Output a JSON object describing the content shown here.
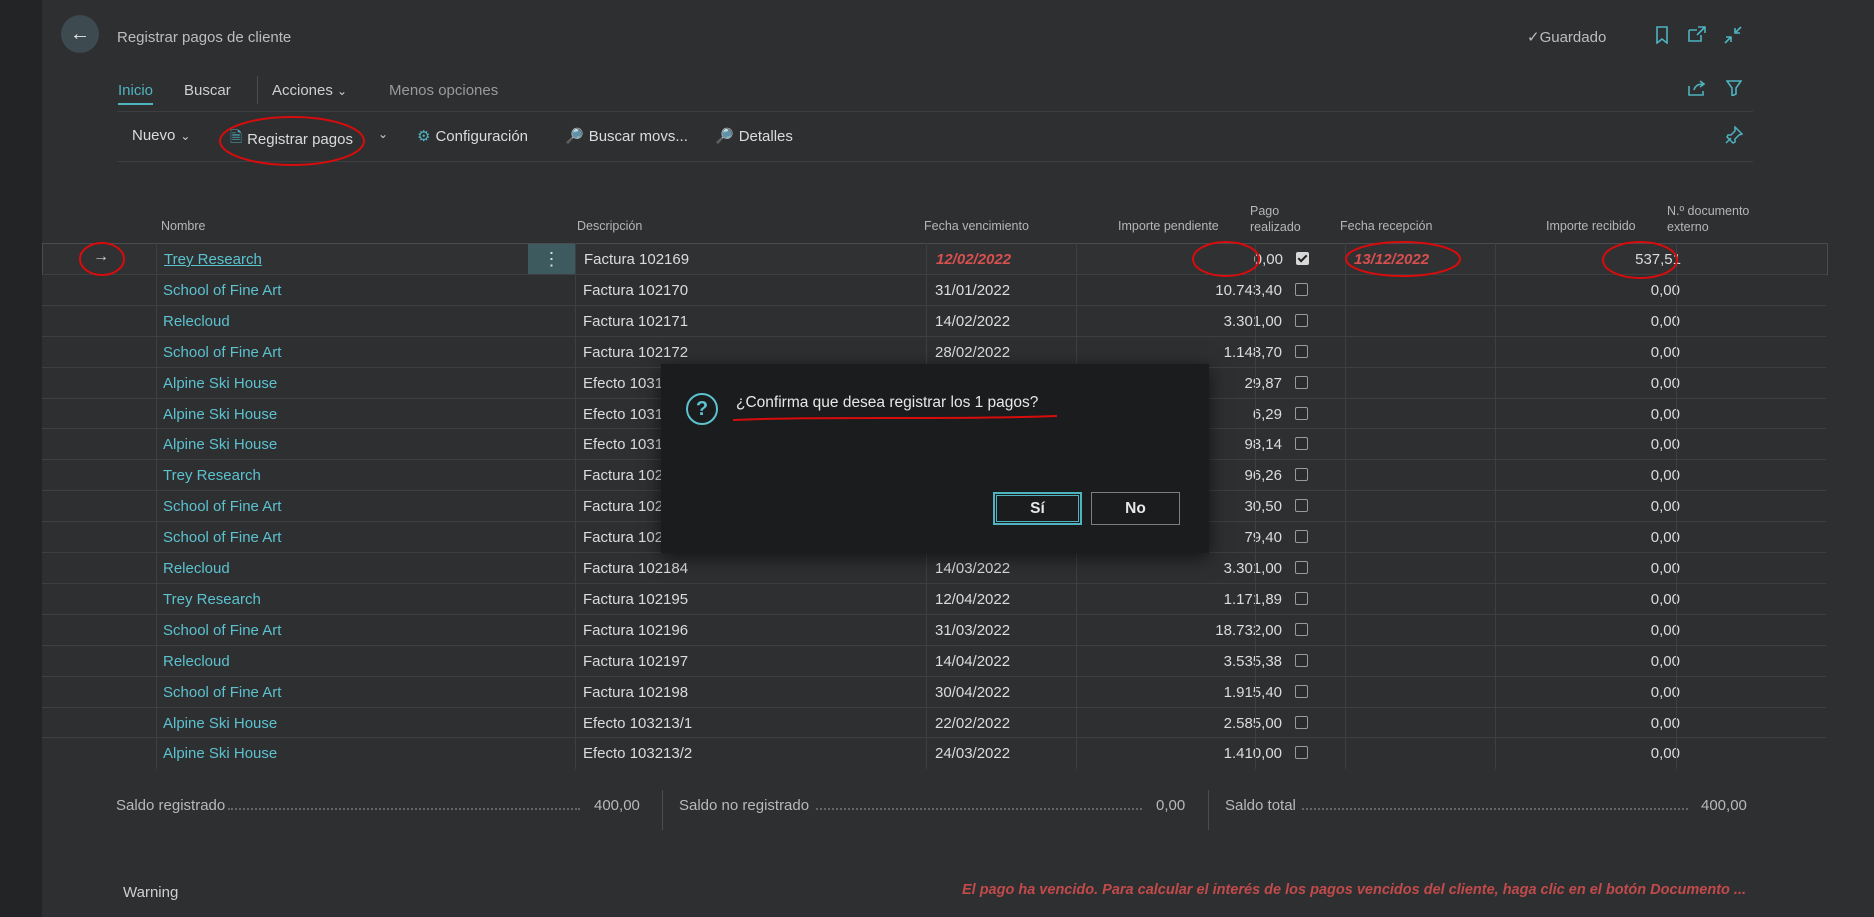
{
  "header": {
    "title": "Registrar pagos de cliente",
    "saved_label": "Guardado"
  },
  "tabs": [
    {
      "label": "Inicio",
      "active": true
    },
    {
      "label": "Buscar"
    },
    {
      "label": "Acciones"
    },
    {
      "label": "Menos opciones"
    }
  ],
  "actions": {
    "nuevo": "Nuevo",
    "registrar_pagos": "Registrar pagos",
    "configuracion": "Configuración",
    "buscar_movs": "Buscar movs...",
    "detalles": "Detalles"
  },
  "columns": {
    "nombre": "Nombre",
    "descripcion": "Descripción",
    "fecha_vencimiento": "Fecha vencimiento",
    "importe_pendiente": "Importe pendiente",
    "pago_realizado_1": "Pago",
    "pago_realizado_2": "realizado",
    "fecha_recepcion": "Fecha recepción",
    "importe_recibido": "Importe recibido",
    "doc_externo_1": "N.º documento",
    "doc_externo_2": "externo"
  },
  "rows": [
    {
      "name": "Trey Research",
      "desc": "Factura 102169",
      "due": "12/02/2022",
      "pending": "0,00",
      "paid": true,
      "received_date": "13/12/2022",
      "received": "537,51"
    },
    {
      "name": "School of Fine Art",
      "desc": "Factura 102170",
      "due": "31/01/2022",
      "pending": "10.743,40",
      "paid": false,
      "received_date": "",
      "received": "0,00"
    },
    {
      "name": "Relecloud",
      "desc": "Factura 102171",
      "due": "14/02/2022",
      "pending": "3.301,00",
      "paid": false,
      "received_date": "",
      "received": "0,00"
    },
    {
      "name": "School of Fine Art",
      "desc": "Factura 102172",
      "due": "28/02/2022",
      "pending": "1.148,70",
      "paid": false,
      "received_date": "",
      "received": "0,00"
    },
    {
      "name": "Alpine Ski House",
      "desc": "Efecto 1031",
      "due": "",
      "pending": "29,87",
      "paid": false,
      "received_date": "",
      "received": "0,00"
    },
    {
      "name": "Alpine Ski House",
      "desc": "Efecto 1031",
      "due": "",
      "pending": "6,29",
      "paid": false,
      "received_date": "",
      "received": "0,00"
    },
    {
      "name": "Alpine Ski House",
      "desc": "Efecto 1031",
      "due": "",
      "pending": "98,14",
      "paid": false,
      "received_date": "",
      "received": "0,00"
    },
    {
      "name": "Trey Research",
      "desc": "Factura 102",
      "due": "",
      "pending": "96,26",
      "paid": false,
      "received_date": "",
      "received": "0,00"
    },
    {
      "name": "School of Fine Art",
      "desc": "Factura 102",
      "due": "",
      "pending": "30,50",
      "paid": false,
      "received_date": "",
      "received": "0,00"
    },
    {
      "name": "School of Fine Art",
      "desc": "Factura 102",
      "due": "",
      "pending": "79,40",
      "paid": false,
      "received_date": "",
      "received": "0,00"
    },
    {
      "name": "Relecloud",
      "desc": "Factura 102184",
      "due": "14/03/2022",
      "pending": "3.301,00",
      "paid": false,
      "received_date": "",
      "received": "0,00"
    },
    {
      "name": "Trey Research",
      "desc": "Factura 102195",
      "due": "12/04/2022",
      "pending": "1.171,89",
      "paid": false,
      "received_date": "",
      "received": "0,00"
    },
    {
      "name": "School of Fine Art",
      "desc": "Factura 102196",
      "due": "31/03/2022",
      "pending": "18.732,00",
      "paid": false,
      "received_date": "",
      "received": "0,00"
    },
    {
      "name": "Relecloud",
      "desc": "Factura 102197",
      "due": "14/04/2022",
      "pending": "3.535,38",
      "paid": false,
      "received_date": "",
      "received": "0,00"
    },
    {
      "name": "School of Fine Art",
      "desc": "Factura 102198",
      "due": "30/04/2022",
      "pending": "1.915,40",
      "paid": false,
      "received_date": "",
      "received": "0,00"
    },
    {
      "name": "Alpine Ski House",
      "desc": "Efecto 103213/1",
      "due": "22/02/2022",
      "pending": "2.585,00",
      "paid": false,
      "received_date": "",
      "received": "0,00"
    },
    {
      "name": "Alpine Ski House",
      "desc": "Efecto 103213/2",
      "due": "24/03/2022",
      "pending": "1.410,00",
      "paid": false,
      "received_date": "",
      "received": "0,00"
    }
  ],
  "totals": {
    "registrado_label": "Saldo registrado",
    "registrado_value": "400,00",
    "no_registrado_label": "Saldo no registrado",
    "no_registrado_value": "0,00",
    "total_label": "Saldo total",
    "total_value": "400,00"
  },
  "footer": {
    "warning_label": "Warning",
    "warning_message": "El pago ha vencido. Para calcular el interés de los pagos vencidos del cliente, haga clic en el botón Documento ..."
  },
  "dialog": {
    "question": "¿Confirma que desea registrar los 1 pagos?",
    "yes": "Sí",
    "no": "No"
  },
  "colors": {
    "accent": "#4fb3c0",
    "link": "#5cc2cf",
    "overdue": "#d84f4f",
    "annotation": "#d80c0c"
  }
}
